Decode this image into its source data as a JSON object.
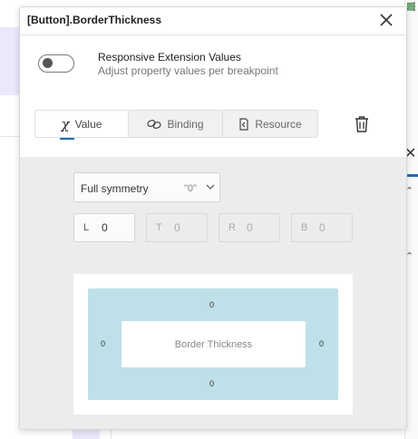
{
  "popup": {
    "title": "[Button].BorderThickness",
    "close_icon": "close-icon"
  },
  "responsive": {
    "title": "Responsive Extension Values",
    "subtitle": "Adjust property values per breakpoint",
    "enabled": false
  },
  "tabs": [
    {
      "label": "Value",
      "icon": "fx-icon",
      "active": true
    },
    {
      "label": "Binding",
      "icon": "link-icon",
      "active": false
    },
    {
      "label": "Resource",
      "icon": "resource-icon",
      "active": false
    }
  ],
  "delete_icon": "trash-icon",
  "symmetry": {
    "label": "Full symmetry",
    "value": "\"0\""
  },
  "fields": [
    {
      "label": "L",
      "value": "0",
      "enabled": true
    },
    {
      "label": "T",
      "value": "0",
      "enabled": false
    },
    {
      "label": "R",
      "value": "0",
      "enabled": false
    },
    {
      "label": "B",
      "value": "0",
      "enabled": false
    }
  ],
  "preview": {
    "label": "Border Thickness",
    "top": "0",
    "bottom": "0",
    "left": "0",
    "right": "0",
    "border_color": "#bfe0e8"
  },
  "colors": {
    "accent": "#1f6fb5"
  }
}
